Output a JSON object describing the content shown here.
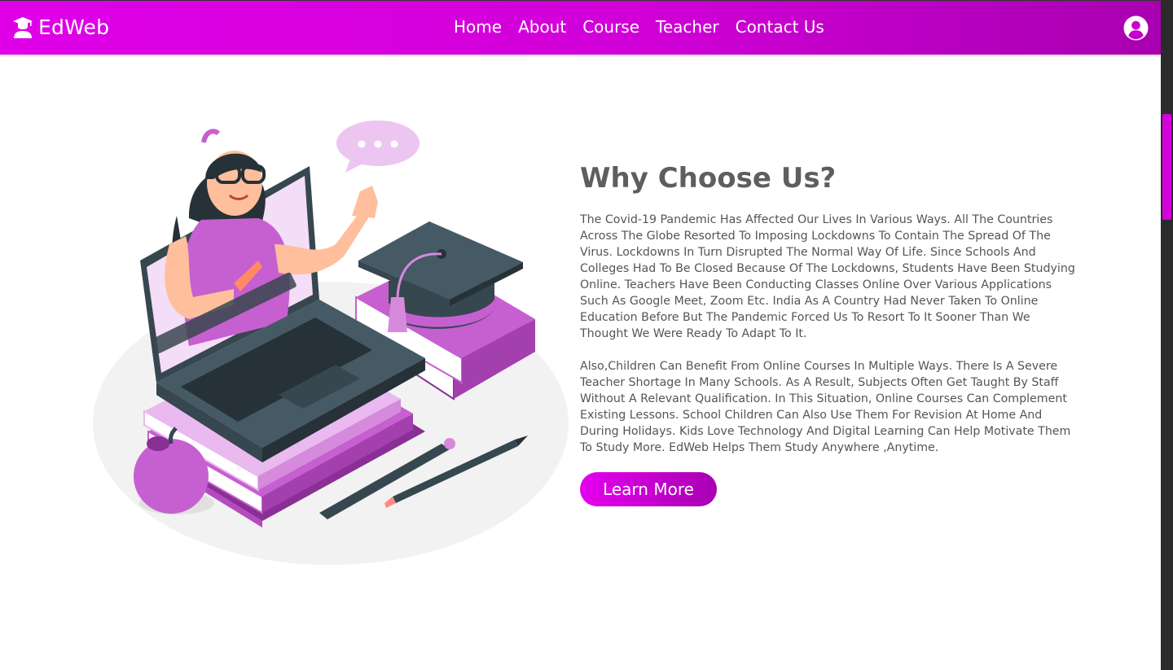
{
  "nav": {
    "brand": "EdWeb",
    "links": [
      "Home",
      "About",
      "Course",
      "Teacher",
      "Contact Us"
    ]
  },
  "icons": {
    "logo": "graduate-student-icon",
    "user": "user-circle-icon"
  },
  "main": {
    "title": "Why Choose Us?",
    "paragraph1": "The Covid-19 Pandemic Has Affected Our Lives In Various Ways. All The Countries Across The Globe Resorted To Imposing Lockdowns To Contain The Spread Of The Virus. Lockdowns In Turn Disrupted The Normal Way Of Life. Since Schools And Colleges Had To Be Closed Because Of The Lockdowns, Students Have Been Studying Online. Teachers Have Been Conducting Classes Online Over Various Applications Such As Google Meet, Zoom Etc. India As A Country Had Never Taken To Online Education Before But The Pandemic Forced Us To Resort To It Sooner Than We Thought We Were Ready To Adapt To It.",
    "paragraph2": "Also,Children Can Benefit From Online Courses In Multiple Ways. There Is A Severe Teacher Shortage In Many Schools. As A Result, Subjects Often Get Taught By Staff Without A Relevant Qualification. In This Situation, Online Courses Can Complement Existing Lessons. School Children Can Also Use Them For Revision At Home And During Holidays. Kids Love Technology And Digital Learning Can Help Motivate Them To Study More. EdWeb Helps Them Study Anywhere ,Anytime.",
    "button": "Learn More"
  },
  "colors": {
    "brand": "#d600dc",
    "brand_dark": "#a800b0",
    "heading": "#5e5e5e",
    "body_text": "#555555"
  }
}
